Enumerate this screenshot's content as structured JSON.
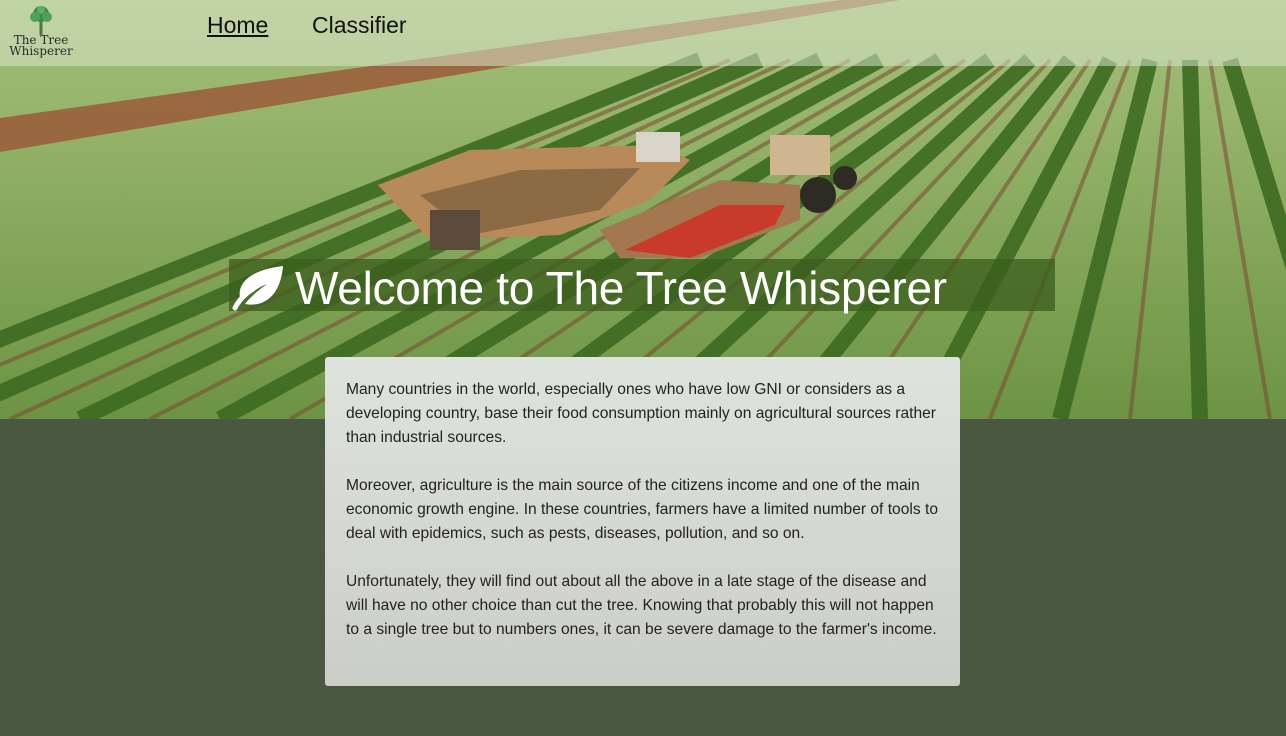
{
  "navbar": {
    "logo": {
      "line1": "The Tree",
      "line2": "Whisperer",
      "icon": "tree-icon"
    },
    "links": [
      {
        "label": "Home",
        "active": true
      },
      {
        "label": "Classifier",
        "active": false
      }
    ]
  },
  "hero": {
    "title": "Welcome to The Tree Whisperer",
    "icon": "leaf-icon"
  },
  "card": {
    "paragraphs": [
      "Many countries in the world, especially ones who have low GNI or considers as a developing country, base their food consumption mainly on agricultural sources rather than industrial sources.",
      "Moreover, agriculture is the main source of the citizens income and one of the main economic growth engine. In these countries, farmers have a limited number of tools to deal with epidemics, such as pests, diseases, pollution, and so on.",
      "Unfortunately, they will find out about all the above in a late stage of the disease and will have no other choice than cut the tree. Knowing that probably this will not happen to a single tree but to numbers ones, it can be severe damage to the farmer's income."
    ]
  },
  "colors": {
    "page_background": "#4a5741",
    "banner_background": "#3c5f1e",
    "title_text": "#ffffff",
    "card_background": "#d8dcd6"
  }
}
